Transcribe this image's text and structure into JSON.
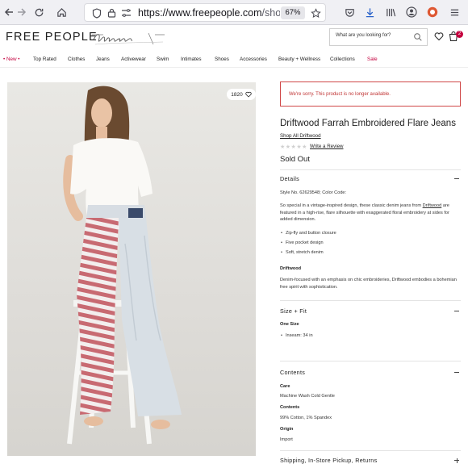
{
  "browser": {
    "url_host": "https://www.freepeople.com",
    "url_path": "/shop/dr",
    "zoom": "67%"
  },
  "header": {
    "logo": "FREE PEOPLE",
    "search_placeholder": "What are you looking for?",
    "cart_count": "2"
  },
  "nav": {
    "items": [
      "• New •",
      "Top Rated",
      "Clothes",
      "Jeans",
      "Activewear",
      "Swim",
      "Intimates",
      "Shoes",
      "Accessories",
      "Beauty + Wellness",
      "Collections",
      "Sale"
    ]
  },
  "image": {
    "likes": "1820"
  },
  "product": {
    "notice": "We're sorry. This product is no longer available.",
    "title": "Driftwood Farrah Embroidered Flare Jeans",
    "shop_all": "Shop All Driftwood",
    "write_review": "Write a Review",
    "status": "Sold Out",
    "stars": "★★★★★"
  },
  "details": {
    "heading": "Details",
    "style_line": "Style No. 62629548; Color Code:",
    "desc_pre": "So special in a vintage-inspired design, these classic denim jeans from",
    "desc_link": "Driftwood",
    "desc_post": "are featured in a high-rise, flare silhouette with exaggerated floral embroidery at sides for added dimension.",
    "bullets": [
      "Zip-fly and button closure",
      "Five pocket design",
      "Soft, stretch denim"
    ],
    "brand_heading": "Driftwood",
    "brand_text": "Denim-focused with an emphasis on chic embroideries, Driftwood embodies a bohemian free spirit with sophistication."
  },
  "size_fit": {
    "heading": "Size + Fit",
    "sub_heading": "One Size",
    "bullet": "Inseam: 34 in"
  },
  "contents": {
    "heading": "Contents",
    "care_heading": "Care",
    "care_text": "Machine Wash Cold Gentle",
    "contents_heading": "Contents",
    "contents_text": "99% Cotton, 1% Spandex",
    "origin_heading": "Origin",
    "origin_text": "Import"
  },
  "shipping": {
    "heading": "Shipping, In-Store Pickup, Returns"
  }
}
